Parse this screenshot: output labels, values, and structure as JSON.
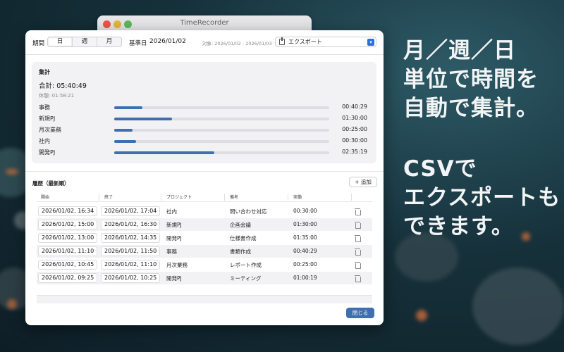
{
  "promo": {
    "block1": [
      "月／週／日",
      "単位で時間を",
      "自動で集計。"
    ],
    "block2": [
      "CSVで",
      "エクスポートも",
      "できます。"
    ]
  },
  "back_window": {
    "title": "TimeRecorder"
  },
  "toolbar": {
    "period_label": "期間",
    "segments": [
      "日",
      "週",
      "月"
    ],
    "selected_segment": "日",
    "base_date_label": "基準日",
    "base_date": "2026/01/02",
    "range_text": "対象: 2026/01/02 - 2026/01/03",
    "export_label": "エクスポート"
  },
  "summary": {
    "title": "集計",
    "total": "合計: 05:40:49",
    "break": "休憩: 01:58:21",
    "categories": [
      {
        "name": "事務",
        "time": "00:40:29",
        "ratio": 0.13
      },
      {
        "name": "新規PJ",
        "time": "01:30:00",
        "ratio": 0.27
      },
      {
        "name": "月次業務",
        "time": "00:25:00",
        "ratio": 0.085
      },
      {
        "name": "社内",
        "time": "00:30:00",
        "ratio": 0.1
      },
      {
        "name": "開発PJ",
        "time": "02:35:19",
        "ratio": 0.465
      }
    ]
  },
  "history": {
    "title": "履歴（最新順）",
    "add_label": "+ 追加",
    "columns": [
      "開始",
      "終了",
      "プロジェクト",
      "備考",
      "実働"
    ],
    "rows": [
      {
        "start": "2026/01/02, 16:34",
        "end": "2026/01/02, 17:04",
        "project": "社内",
        "note": "問い合わせ対応",
        "worked": "00:30:00"
      },
      {
        "start": "2026/01/02, 15:00",
        "end": "2026/01/02, 16:30",
        "project": "新規PJ",
        "note": "企画会議",
        "worked": "01:30:00"
      },
      {
        "start": "2026/01/02, 13:00",
        "end": "2026/01/02, 14:35",
        "project": "開発PJ",
        "note": "仕様書作成",
        "worked": "01:35:00"
      },
      {
        "start": "2026/01/02, 11:10",
        "end": "2026/01/02, 11:50",
        "project": "事務",
        "note": "書類作成",
        "worked": "00:40:29"
      },
      {
        "start": "2026/01/02, 10:45",
        "end": "2026/01/02, 11:10",
        "project": "月次業務",
        "note": "レポート作成",
        "worked": "00:25:00"
      },
      {
        "start": "2026/01/02, 09:25",
        "end": "2026/01/02, 10:25",
        "project": "開発PJ",
        "note": "ミーティング",
        "worked": "01:00:19"
      }
    ]
  },
  "close_label": "閉じる",
  "colors": {
    "accent": "#3f6fb0",
    "export_caret": "#2f6fdc",
    "traffic_close": "#e9574b",
    "traffic_min": "#e8b43a",
    "traffic_max": "#5cb85c"
  }
}
